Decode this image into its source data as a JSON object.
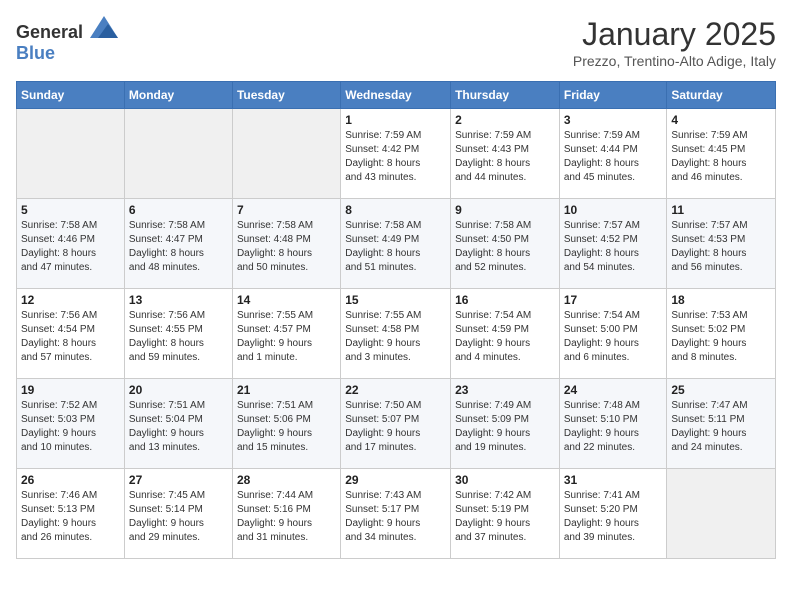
{
  "header": {
    "logo_general": "General",
    "logo_blue": "Blue",
    "month": "January 2025",
    "location": "Prezzo, Trentino-Alto Adige, Italy"
  },
  "weekdays": [
    "Sunday",
    "Monday",
    "Tuesday",
    "Wednesday",
    "Thursday",
    "Friday",
    "Saturday"
  ],
  "weeks": [
    [
      {
        "day": "",
        "info": ""
      },
      {
        "day": "",
        "info": ""
      },
      {
        "day": "",
        "info": ""
      },
      {
        "day": "1",
        "info": "Sunrise: 7:59 AM\nSunset: 4:42 PM\nDaylight: 8 hours\nand 43 minutes."
      },
      {
        "day": "2",
        "info": "Sunrise: 7:59 AM\nSunset: 4:43 PM\nDaylight: 8 hours\nand 44 minutes."
      },
      {
        "day": "3",
        "info": "Sunrise: 7:59 AM\nSunset: 4:44 PM\nDaylight: 8 hours\nand 45 minutes."
      },
      {
        "day": "4",
        "info": "Sunrise: 7:59 AM\nSunset: 4:45 PM\nDaylight: 8 hours\nand 46 minutes."
      }
    ],
    [
      {
        "day": "5",
        "info": "Sunrise: 7:58 AM\nSunset: 4:46 PM\nDaylight: 8 hours\nand 47 minutes."
      },
      {
        "day": "6",
        "info": "Sunrise: 7:58 AM\nSunset: 4:47 PM\nDaylight: 8 hours\nand 48 minutes."
      },
      {
        "day": "7",
        "info": "Sunrise: 7:58 AM\nSunset: 4:48 PM\nDaylight: 8 hours\nand 50 minutes."
      },
      {
        "day": "8",
        "info": "Sunrise: 7:58 AM\nSunset: 4:49 PM\nDaylight: 8 hours\nand 51 minutes."
      },
      {
        "day": "9",
        "info": "Sunrise: 7:58 AM\nSunset: 4:50 PM\nDaylight: 8 hours\nand 52 minutes."
      },
      {
        "day": "10",
        "info": "Sunrise: 7:57 AM\nSunset: 4:52 PM\nDaylight: 8 hours\nand 54 minutes."
      },
      {
        "day": "11",
        "info": "Sunrise: 7:57 AM\nSunset: 4:53 PM\nDaylight: 8 hours\nand 56 minutes."
      }
    ],
    [
      {
        "day": "12",
        "info": "Sunrise: 7:56 AM\nSunset: 4:54 PM\nDaylight: 8 hours\nand 57 minutes."
      },
      {
        "day": "13",
        "info": "Sunrise: 7:56 AM\nSunset: 4:55 PM\nDaylight: 8 hours\nand 59 minutes."
      },
      {
        "day": "14",
        "info": "Sunrise: 7:55 AM\nSunset: 4:57 PM\nDaylight: 9 hours\nand 1 minute."
      },
      {
        "day": "15",
        "info": "Sunrise: 7:55 AM\nSunset: 4:58 PM\nDaylight: 9 hours\nand 3 minutes."
      },
      {
        "day": "16",
        "info": "Sunrise: 7:54 AM\nSunset: 4:59 PM\nDaylight: 9 hours\nand 4 minutes."
      },
      {
        "day": "17",
        "info": "Sunrise: 7:54 AM\nSunset: 5:00 PM\nDaylight: 9 hours\nand 6 minutes."
      },
      {
        "day": "18",
        "info": "Sunrise: 7:53 AM\nSunset: 5:02 PM\nDaylight: 9 hours\nand 8 minutes."
      }
    ],
    [
      {
        "day": "19",
        "info": "Sunrise: 7:52 AM\nSunset: 5:03 PM\nDaylight: 9 hours\nand 10 minutes."
      },
      {
        "day": "20",
        "info": "Sunrise: 7:51 AM\nSunset: 5:04 PM\nDaylight: 9 hours\nand 13 minutes."
      },
      {
        "day": "21",
        "info": "Sunrise: 7:51 AM\nSunset: 5:06 PM\nDaylight: 9 hours\nand 15 minutes."
      },
      {
        "day": "22",
        "info": "Sunrise: 7:50 AM\nSunset: 5:07 PM\nDaylight: 9 hours\nand 17 minutes."
      },
      {
        "day": "23",
        "info": "Sunrise: 7:49 AM\nSunset: 5:09 PM\nDaylight: 9 hours\nand 19 minutes."
      },
      {
        "day": "24",
        "info": "Sunrise: 7:48 AM\nSunset: 5:10 PM\nDaylight: 9 hours\nand 22 minutes."
      },
      {
        "day": "25",
        "info": "Sunrise: 7:47 AM\nSunset: 5:11 PM\nDaylight: 9 hours\nand 24 minutes."
      }
    ],
    [
      {
        "day": "26",
        "info": "Sunrise: 7:46 AM\nSunset: 5:13 PM\nDaylight: 9 hours\nand 26 minutes."
      },
      {
        "day": "27",
        "info": "Sunrise: 7:45 AM\nSunset: 5:14 PM\nDaylight: 9 hours\nand 29 minutes."
      },
      {
        "day": "28",
        "info": "Sunrise: 7:44 AM\nSunset: 5:16 PM\nDaylight: 9 hours\nand 31 minutes."
      },
      {
        "day": "29",
        "info": "Sunrise: 7:43 AM\nSunset: 5:17 PM\nDaylight: 9 hours\nand 34 minutes."
      },
      {
        "day": "30",
        "info": "Sunrise: 7:42 AM\nSunset: 5:19 PM\nDaylight: 9 hours\nand 37 minutes."
      },
      {
        "day": "31",
        "info": "Sunrise: 7:41 AM\nSunset: 5:20 PM\nDaylight: 9 hours\nand 39 minutes."
      },
      {
        "day": "",
        "info": ""
      }
    ]
  ]
}
